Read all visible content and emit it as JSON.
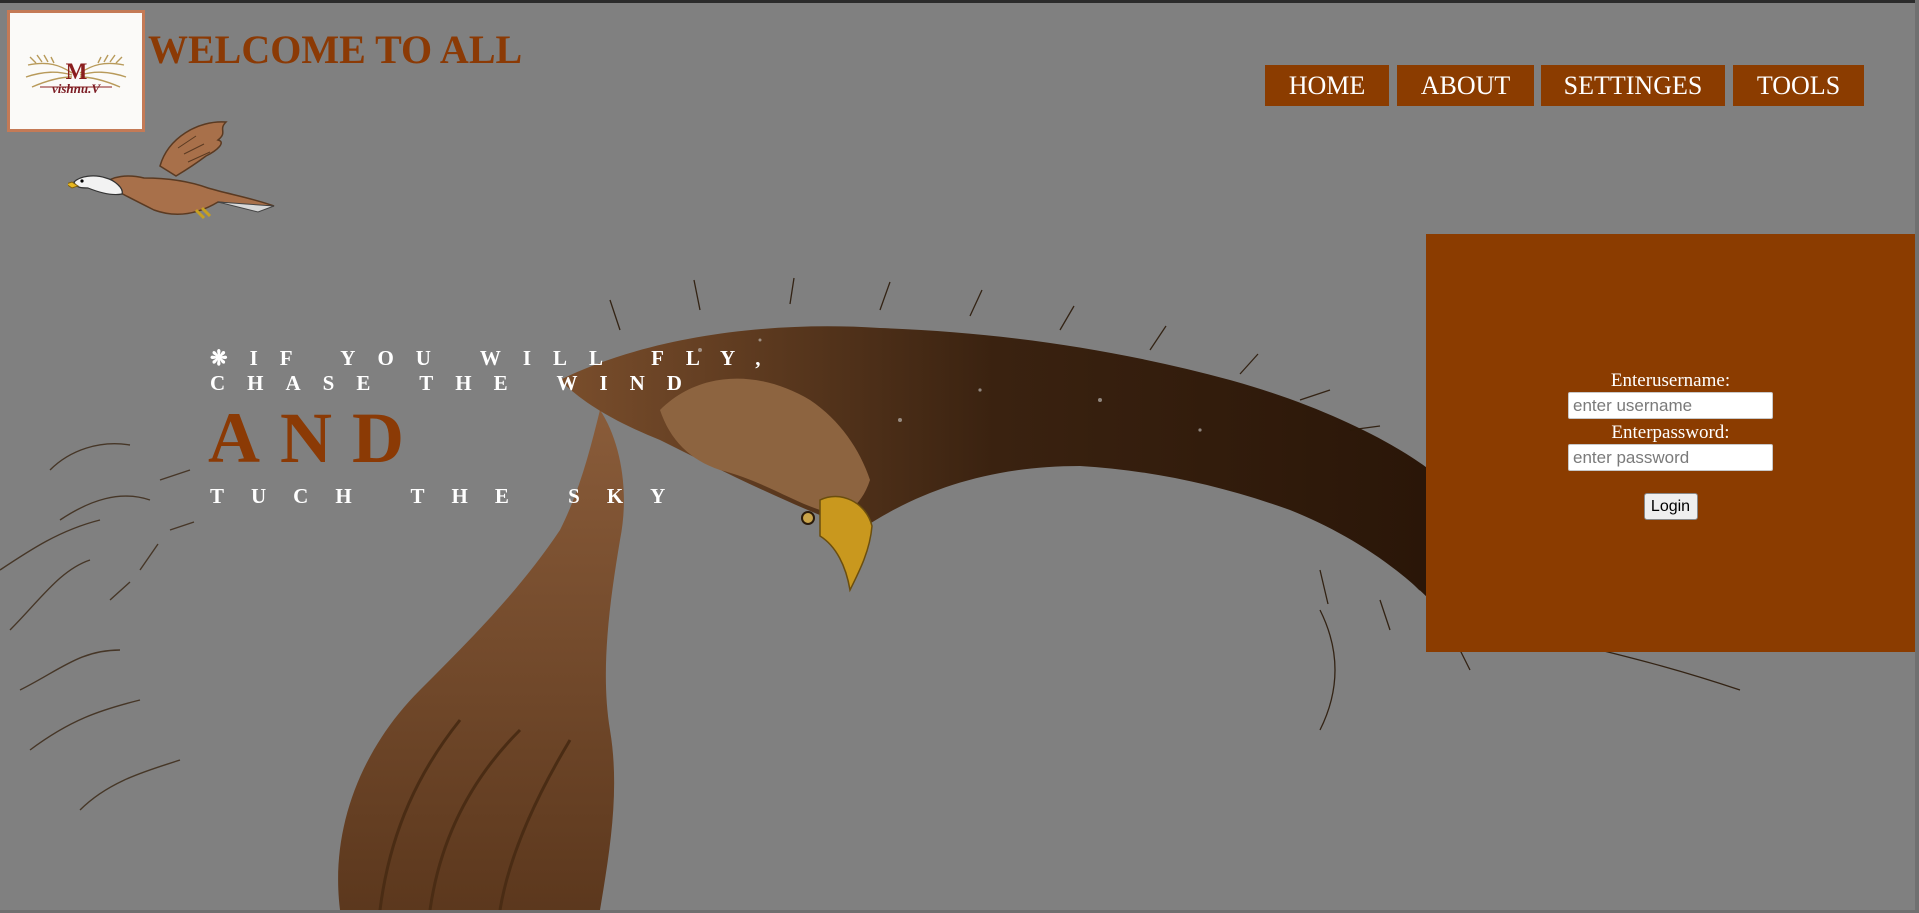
{
  "header": {
    "logo_monogram": "M",
    "logo_name": "vishnu.V",
    "welcome_text": "WELCOME TO ALL"
  },
  "nav": {
    "items": [
      {
        "label": "HOME"
      },
      {
        "label": "ABOUT"
      },
      {
        "label": "SETTINGES"
      },
      {
        "label": "TOOLS"
      }
    ]
  },
  "hero": {
    "line1": "❋IF YOU WILL FLY,",
    "line2": "CHASE THE WIND",
    "line3": "AND",
    "line4": "TUCH THE SKY"
  },
  "login": {
    "username_label": "Enterusername:",
    "username_placeholder": "enter username",
    "password_label": "Enterpassword:",
    "password_placeholder": "enter password",
    "button_label": "Login"
  },
  "colors": {
    "background": "#808080",
    "accent": "#8b3c00",
    "title": "#8b3a05",
    "logo_border": "#c47a56"
  },
  "icons": {
    "logo": "wings-monogram-logo",
    "small_eagle": "flying-eagle-icon",
    "hero_image": "eagle-splash-illustration"
  }
}
